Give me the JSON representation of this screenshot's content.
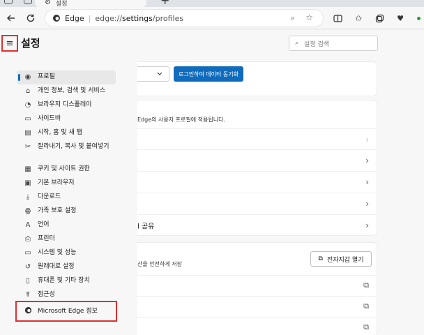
{
  "tab": {
    "title": "설정"
  },
  "browser": {
    "brand": "Edge",
    "url_prefix": "edge://",
    "url_bold": "settings",
    "url_suffix": "/profiles"
  },
  "settings": {
    "title": "설정",
    "search_placeholder": "설정 검색",
    "nav": [
      {
        "label": "프로필",
        "icon": "profile-icon",
        "active": true
      },
      {
        "label": "개인 정보, 검색 및 서비스",
        "icon": "lock-icon"
      },
      {
        "label": "브라우저 디스플레이",
        "icon": "appearance-icon"
      },
      {
        "label": "사이드바",
        "icon": "sidebar-icon"
      },
      {
        "label": "시작, 홈 및 새 탭",
        "icon": "start-home-icon"
      },
      {
        "label": "잘라내기, 복사 및 붙여넣기",
        "icon": "clipboard-icon"
      },
      {
        "label": "쿠키 및 사이트 권한",
        "icon": "cookie-icon"
      },
      {
        "label": "기본 브라우저",
        "icon": "default-browser-icon"
      },
      {
        "label": "다운로드",
        "icon": "download-icon"
      },
      {
        "label": "가족 보호 설정",
        "icon": "family-icon"
      },
      {
        "label": "언어",
        "icon": "language-icon"
      },
      {
        "label": "프린터",
        "icon": "printer-icon"
      },
      {
        "label": "시스템 및 성능",
        "icon": "system-icon"
      },
      {
        "label": "원래대로 설정",
        "icon": "reset-icon"
      },
      {
        "label": "휴대폰 및 기타 장치",
        "icon": "phone-icon"
      },
      {
        "label": "접근성",
        "icon": "accessibility-icon"
      },
      {
        "label": "Microsoft Edge 정보",
        "icon": "edge-logo-icon"
      }
    ]
  },
  "main": {
    "sync_button": "로그인하여 데이터 동기화",
    "profile_note": "Edge의 사용자 프로필에 적용됩니다.",
    "share_label": "l 공유",
    "wallet_note": "산을 안전하게 저장",
    "wallet_button": "전자지갑 열기"
  }
}
